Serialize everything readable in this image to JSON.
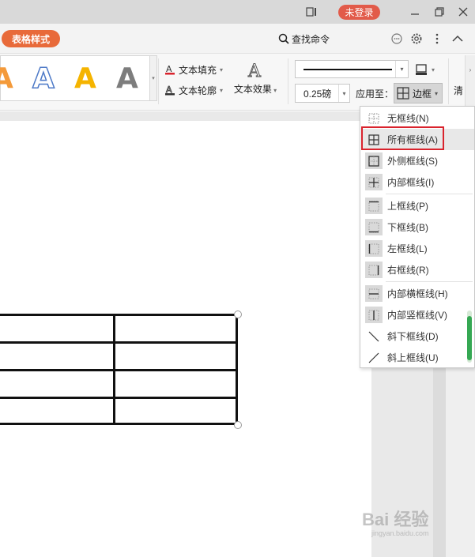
{
  "titlebar": {
    "login_label": "未登录"
  },
  "menubar": {
    "active_tab": "表格样式",
    "search_label": "查找命令"
  },
  "ribbon": {
    "art_letters": [
      "A",
      "A",
      "A",
      "A"
    ],
    "text_fill": "文本填充",
    "text_outline": "文本轮廓",
    "text_effect": "文本效果",
    "line_weight": "0.25磅",
    "apply_to": "应用至：",
    "border_label": "边框",
    "clear_label": "清"
  },
  "border_menu": {
    "items": [
      {
        "label": "无框线(N)",
        "icon": "no-border-icon"
      },
      {
        "label": "所有框线(A)",
        "icon": "all-borders-icon"
      },
      {
        "label": "外侧框线(S)",
        "icon": "outside-borders-icon"
      },
      {
        "label": "内部框线(I)",
        "icon": "inside-borders-icon"
      },
      {
        "label": "上框线(P)",
        "icon": "top-border-icon"
      },
      {
        "label": "下框线(B)",
        "icon": "bottom-border-icon"
      },
      {
        "label": "左框线(L)",
        "icon": "left-border-icon"
      },
      {
        "label": "右框线(R)",
        "icon": "right-border-icon"
      },
      {
        "label": "内部横框线(H)",
        "icon": "inside-horizontal-border-icon"
      },
      {
        "label": "内部竖框线(V)",
        "icon": "inside-vertical-border-icon"
      },
      {
        "label": "斜下框线(D)",
        "icon": "diagonal-down-border-icon"
      },
      {
        "label": "斜上框线(U)",
        "icon": "diagonal-up-border-icon"
      }
    ],
    "highlighted": "所有框线(A)"
  },
  "colors": {
    "login": "#e25b4a",
    "active_tab": "#e86a3a",
    "highlight": "#d9232d",
    "scroll_thumb": "#35a853"
  },
  "watermark": {
    "text": "Bai 经验",
    "sub": "jingyan.baidu.com"
  }
}
